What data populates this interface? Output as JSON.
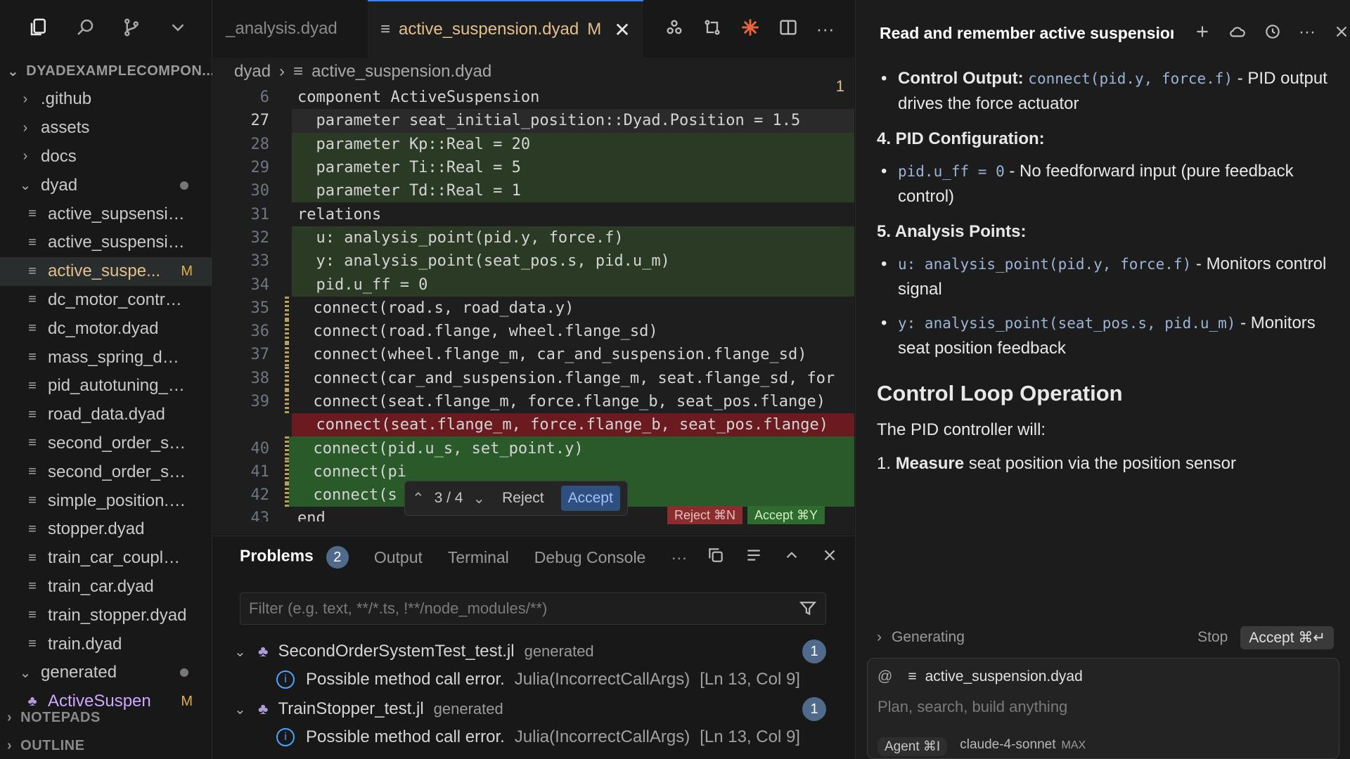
{
  "explorer": {
    "root": "DYADEXAMPLECOMPON...",
    "items": [
      {
        "label": ".github",
        "kind": "folder",
        "open": false,
        "indent": 0
      },
      {
        "label": "assets",
        "kind": "folder",
        "open": false,
        "indent": 0
      },
      {
        "label": "docs",
        "kind": "folder",
        "open": false,
        "indent": 0
      },
      {
        "label": "dyad",
        "kind": "folder",
        "open": true,
        "indent": 0
      },
      {
        "label": "active_supsension...",
        "kind": "file",
        "indent": 1
      },
      {
        "label": "active_suspension...",
        "kind": "file",
        "indent": 1
      },
      {
        "label": "active_suspe...",
        "kind": "file",
        "indent": 1,
        "badge": "M"
      },
      {
        "label": "dc_motor_controll...",
        "kind": "file",
        "indent": 1
      },
      {
        "label": "dc_motor.dyad",
        "kind": "file",
        "indent": 1
      },
      {
        "label": "mass_spring_dam...",
        "kind": "file",
        "indent": 1
      },
      {
        "label": "pid_autotuning_an...",
        "kind": "file",
        "indent": 1
      },
      {
        "label": "road_data.dyad",
        "kind": "file",
        "indent": 1
      },
      {
        "label": "second_order_syst...",
        "kind": "file",
        "indent": 1
      },
      {
        "label": "second_order_syst...",
        "kind": "file",
        "indent": 1
      },
      {
        "label": "simple_position.dy...",
        "kind": "file",
        "indent": 1
      },
      {
        "label": "stopper.dyad",
        "kind": "file",
        "indent": 1
      },
      {
        "label": "train_car_coupler.d...",
        "kind": "file",
        "indent": 1
      },
      {
        "label": "train_car.dyad",
        "kind": "file",
        "indent": 1
      },
      {
        "label": "train_stopper.dyad",
        "kind": "file",
        "indent": 1
      },
      {
        "label": "train.dyad",
        "kind": "file",
        "indent": 1
      },
      {
        "label": "generated",
        "kind": "folder",
        "open": true,
        "indent": 0
      },
      {
        "label": "ActiveSuspen",
        "kind": "file",
        "indent": 1,
        "badge": "M"
      }
    ],
    "notepads": "NOTEPADS",
    "outline": "OUTLINE"
  },
  "tabs": {
    "inactive": "_analysis.dyad",
    "active": "active_suspension.dyad",
    "active_badge": "M"
  },
  "breadcrumb": {
    "folder": "dyad",
    "file": "active_suspension.dyad"
  },
  "editor": {
    "hint": "1",
    "lines": [
      {
        "n": "6",
        "text": "component ActiveSuspension",
        "style": ""
      },
      {
        "n": "27",
        "text": "  parameter seat_initial_position::Dyad.Position = 1.5",
        "style": "hl",
        "cur": true
      },
      {
        "n": "28",
        "text": "  parameter Kp::Real = 20",
        "style": "add"
      },
      {
        "n": "29",
        "text": "  parameter Ti::Real = 5",
        "style": "add"
      },
      {
        "n": "30",
        "text": "  parameter Td::Real = 1",
        "style": "add"
      },
      {
        "n": "31",
        "text": "relations",
        "style": ""
      },
      {
        "n": "32",
        "text": "  u: analysis_point(pid.y, force.f)",
        "style": "add"
      },
      {
        "n": "33",
        "text": "  y: analysis_point(seat_pos.s, pid.u_m)",
        "style": "add"
      },
      {
        "n": "34",
        "text": "  pid.u_ff = 0",
        "style": "add"
      },
      {
        "n": "35",
        "text": "  connect(road.s, road_data.y)",
        "style": "",
        "mark": true
      },
      {
        "n": "36",
        "text": "  connect(road.flange, wheel.flange_sd)",
        "style": "",
        "mark": true
      },
      {
        "n": "37",
        "text": "  connect(wheel.flange_m, car_and_suspension.flange_sd)",
        "style": "",
        "mark": true
      },
      {
        "n": "38",
        "text": "  connect(car_and_suspension.flange_m, seat.flange_sd, for",
        "style": "",
        "mark": true
      },
      {
        "n": "39",
        "text": "  connect(seat.flange_m, force.flange_b, seat_pos.flange)",
        "style": "",
        "mark": true
      },
      {
        "n": "",
        "text": "  connect(seat.flange_m, force.flange_b, seat_pos.flange)",
        "style": "del"
      },
      {
        "n": "40",
        "text": "  connect(pid.u_s, set_point.y)",
        "style": "add2",
        "mark": true
      },
      {
        "n": "41",
        "text": "  connect(pi",
        "style": "add2",
        "mark": true
      },
      {
        "n": "42",
        "text": "  connect(s",
        "style": "add2",
        "mark": true
      },
      {
        "n": "43",
        "text": "end",
        "style": ""
      }
    ],
    "diff": {
      "counter": "3 / 4",
      "reject": "Reject",
      "accept": "Accept"
    },
    "kb_reject": "Reject ⌘N",
    "kb_accept": "Accept ⌘Y"
  },
  "panel": {
    "tabs": [
      "Problems",
      "Output",
      "Terminal",
      "Debug Console"
    ],
    "problems_count": "2",
    "filter_placeholder": "Filter (e.g. text, **/*.ts, !**/node_modules/**)",
    "groups": [
      {
        "file": "SecondOrderSystemTest_test.jl",
        "tag": "generated",
        "count": "1",
        "msg": "Possible method call error.",
        "src": "Julia(IncorrectCallArgs)",
        "loc": "[Ln 13, Col 9]"
      },
      {
        "file": "TrainStopper_test.jl",
        "tag": "generated",
        "count": "1",
        "msg": "Possible method call error.",
        "src": "Julia(IncorrectCallArgs)",
        "loc": "[Ln 13, Col 9]"
      }
    ]
  },
  "chat": {
    "title": "Read and remember active suspension",
    "control_output_label": "Control Output",
    "control_output_code": "connect(pid.y, force.f)",
    "control_output_text": "- PID output drives the force actuator",
    "pid_heading": "4. PID Configuration:",
    "pid_code": "pid.u_ff = 0",
    "pid_text": "- No feedforward input (pure feedback control)",
    "ap_heading": "5. Analysis Points:",
    "ap_u_code": "u: analysis_point(pid.y, force.f)",
    "ap_u_text": "- Monitors control signal",
    "ap_y_code": "y: analysis_point(seat_pos.s, pid.u_m)",
    "ap_y_text": "- Monitors seat position feedback",
    "loop_heading": "Control Loop Operation",
    "loop_intro": "The PID controller will:",
    "loop_step1_bold": "Measure",
    "loop_step1_text": "seat position via the position sensor",
    "generating": "Generating",
    "stop": "Stop",
    "accept": "Accept ⌘↵",
    "context_file": "active_suspension.dyad",
    "placeholder": "Plan, search, build anything",
    "agent": "Agent ⌘I",
    "model": "claude-4-sonnet",
    "model_tag": "MAX"
  }
}
